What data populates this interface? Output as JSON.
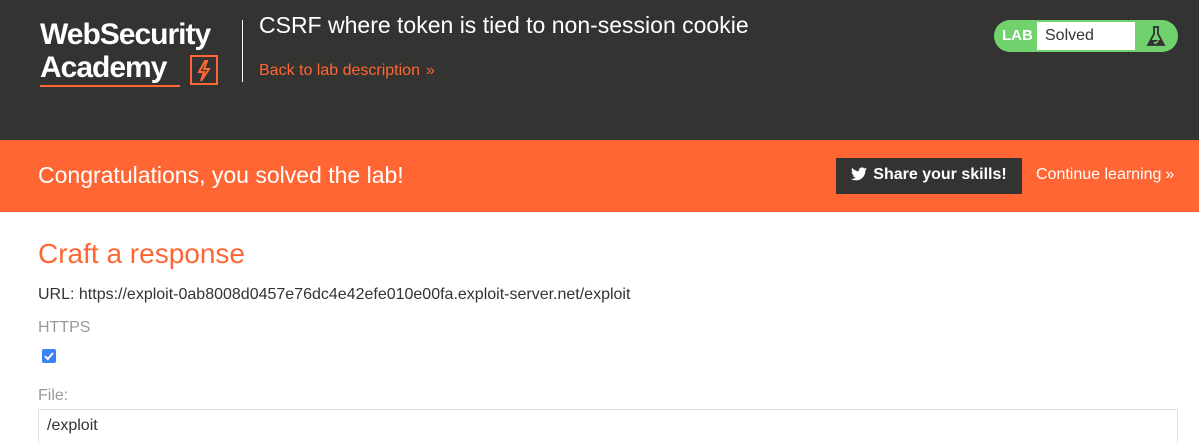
{
  "header": {
    "logo_line1": "WebSecurity",
    "logo_line2": "Academy",
    "lab_title": "CSRF where token is tied to non-session cookie",
    "back_link": "Back to lab description",
    "back_chevron": "»"
  },
  "status": {
    "badge": "LAB",
    "state": "Solved",
    "icon": "flask-icon",
    "color": "#70d16d"
  },
  "banner": {
    "message": "Congratulations, you solved the lab!",
    "share_label": "Share your skills!",
    "share_icon": "twitter-icon",
    "continue_label": "Continue learning",
    "continue_chevron": "»",
    "color": "#ff6633"
  },
  "content": {
    "title": "Craft a response",
    "url_line": "URL: https://exploit-0ab8008d0457e76dc4e42efe010e00fa.exploit-server.net/exploit",
    "https_label": "HTTPS",
    "https_checked": true,
    "file_label": "File:",
    "file_value": "/exploit"
  }
}
